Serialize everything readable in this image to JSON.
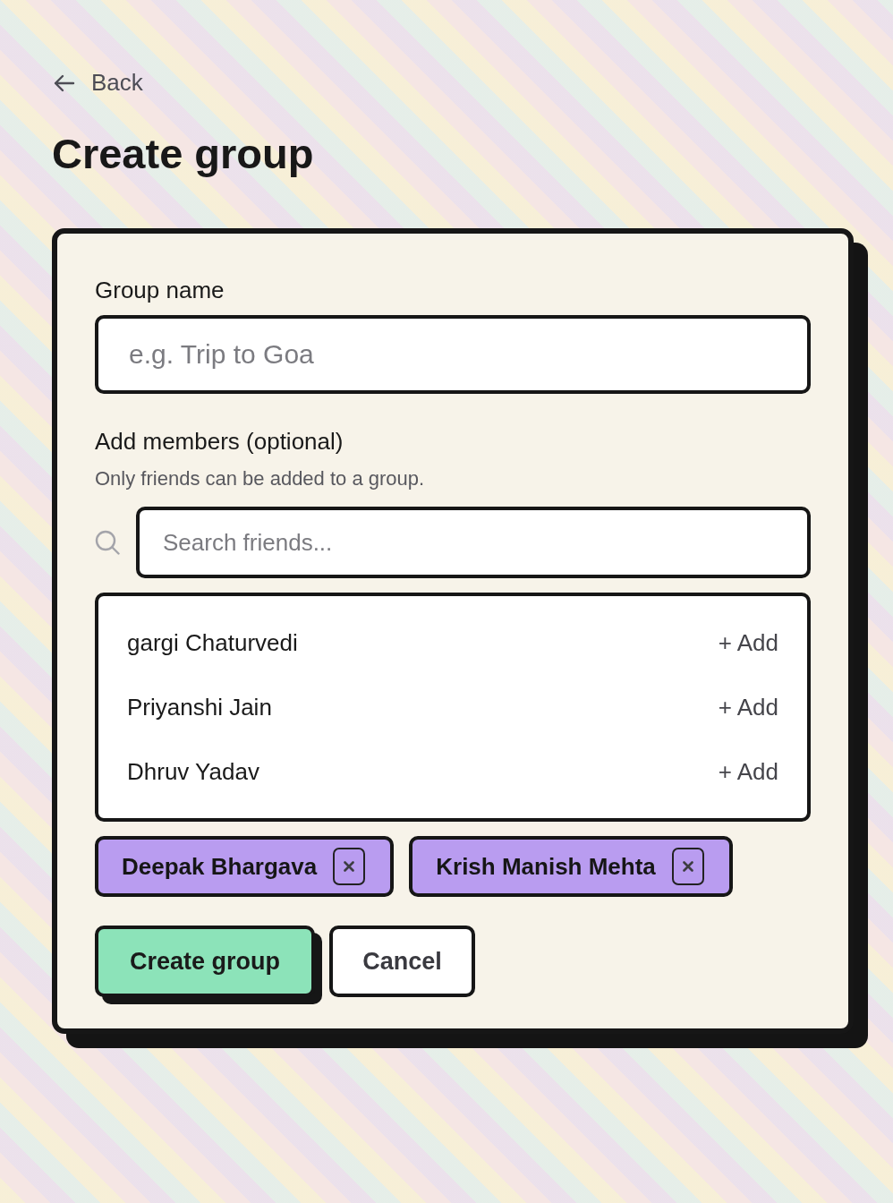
{
  "back_link": {
    "label": "Back"
  },
  "title": "Create group",
  "form": {
    "group_name": {
      "label": "Group name",
      "placeholder": "e.g. Trip to Goa"
    },
    "members": {
      "label": "Add members (optional)",
      "hint": "Only friends can be added to a group.",
      "search": {
        "placeholder": "Search friends..."
      },
      "friends": [
        {
          "name": "gargi Chaturvedi",
          "action": "+ Add"
        },
        {
          "name": "Priyanshi Jain",
          "action": "+ Add"
        },
        {
          "name": "Dhruv Yadav",
          "action": "+ Add"
        }
      ],
      "selected": [
        {
          "name": "Deepak Bhargava"
        },
        {
          "name": "Krish Manish Mehta"
        }
      ]
    },
    "buttons": [
      {
        "label": "Create group",
        "kind": "primary"
      },
      {
        "label": "Cancel",
        "kind": "secondary"
      }
    ]
  }
}
